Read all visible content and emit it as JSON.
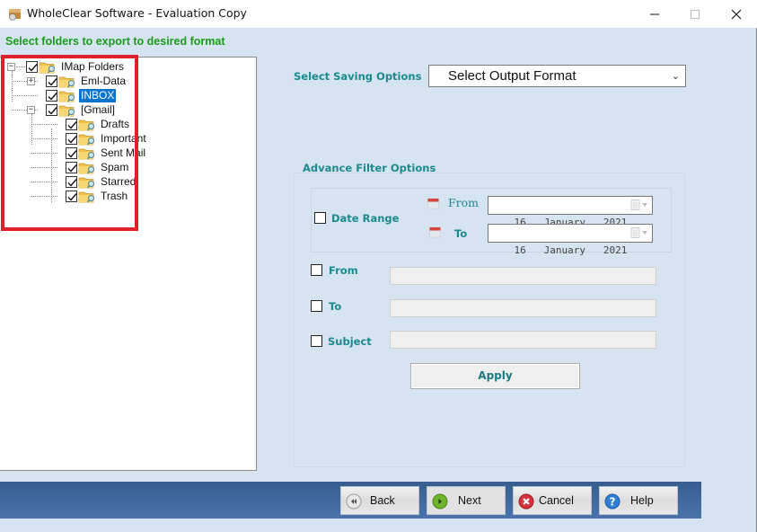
{
  "window": {
    "title": "WholeClear Software - Evaluation Copy",
    "controls": {
      "minimize": "minimize",
      "maximize": "maximize",
      "close": "close"
    }
  },
  "left_panel": {
    "heading": "Select folders to export to desired format",
    "heading_color": "#1c9a1c",
    "highlight_color": "#e0202a",
    "tree": [
      {
        "label": "IMap Folders",
        "level": 0,
        "expander": "−",
        "checked": true,
        "selected": false
      },
      {
        "label": "Eml-Data",
        "level": 1,
        "expander": "+",
        "checked": true,
        "selected": false
      },
      {
        "label": "INBOX",
        "level": 1,
        "expander": "",
        "checked": true,
        "selected": true
      },
      {
        "label": "[Gmail]",
        "level": 1,
        "expander": "−",
        "checked": true,
        "selected": false
      },
      {
        "label": "Drafts",
        "level": 2,
        "expander": "",
        "checked": true,
        "selected": false
      },
      {
        "label": "Important",
        "level": 2,
        "expander": "",
        "checked": true,
        "selected": false
      },
      {
        "label": "Sent Mail",
        "level": 2,
        "expander": "",
        "checked": true,
        "selected": false
      },
      {
        "label": "Spam",
        "level": 2,
        "expander": "",
        "checked": true,
        "selected": false
      },
      {
        "label": "Starred",
        "level": 2,
        "expander": "",
        "checked": true,
        "selected": false
      },
      {
        "label": "Trash",
        "level": 2,
        "expander": "",
        "checked": true,
        "selected": false
      }
    ]
  },
  "saving": {
    "label": "Select Saving Options",
    "format_select_value": "Select Output Format"
  },
  "filter": {
    "title": "Advance Filter Options",
    "accent_color": "#1a8a8e",
    "date_range": {
      "label": "Date Range",
      "checked": false,
      "from_label": "From",
      "to_label": "To",
      "from_value": "16   January   2021",
      "to_value": "16   January   2021"
    },
    "from": {
      "label": "From",
      "checked": false,
      "value": ""
    },
    "to": {
      "label": "To",
      "checked": false,
      "value": ""
    },
    "subject": {
      "label": "Subject",
      "checked": false,
      "value": ""
    },
    "apply_label": "Apply"
  },
  "footer": {
    "back_label": "Back",
    "next_label": "Next",
    "cancel_label": "Cancel",
    "help_label": "Help",
    "bar_color": "#3e659c"
  }
}
